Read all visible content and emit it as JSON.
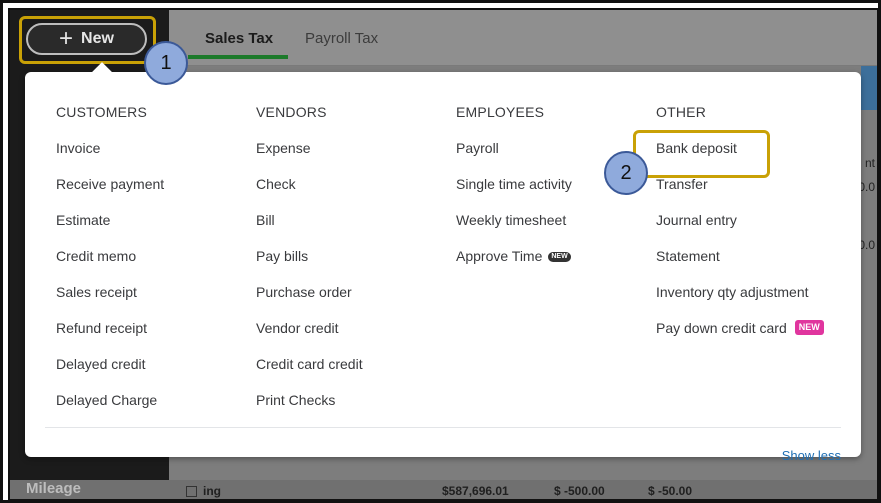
{
  "header": {
    "new_button_label": "New",
    "tabs": [
      "Sales Tax",
      "Payroll Tax"
    ]
  },
  "callouts": [
    "1",
    "2"
  ],
  "menu": {
    "columns": [
      {
        "heading": "CUSTOMERS",
        "items": [
          "Invoice",
          "Receive payment",
          "Estimate",
          "Credit memo",
          "Sales receipt",
          "Refund receipt",
          "Delayed credit",
          "Delayed Charge"
        ]
      },
      {
        "heading": "VENDORS",
        "items": [
          "Expense",
          "Check",
          "Bill",
          "Pay bills",
          "Purchase order",
          "Vendor credit",
          "Credit card credit",
          "Print Checks"
        ]
      },
      {
        "heading": "EMPLOYEES",
        "items": [
          "Payroll",
          "Single time activity",
          "Weekly timesheet",
          "Approve Time"
        ]
      },
      {
        "heading": "OTHER",
        "items": [
          "Bank deposit",
          "Transfer",
          "Journal entry",
          "Statement",
          "Inventory qty adjustment",
          "Pay down credit card"
        ]
      }
    ],
    "new_badge": "NEW",
    "show_less": "Show less"
  },
  "background": {
    "left_nav_bottom_item": "Mileage",
    "bottom_row": [
      "ing",
      "$587,696.01",
      "$ -500.00",
      "$ -50.00"
    ],
    "right_fragments": [
      "nt",
      "0.0",
      "0.0"
    ]
  },
  "colors": {
    "highlight": "#c9a106",
    "callout_fill": "#8faadc",
    "link": "#1f6fb4",
    "tab_underline": "#1c7a2a",
    "new_badge_pink": "#e0359e"
  }
}
